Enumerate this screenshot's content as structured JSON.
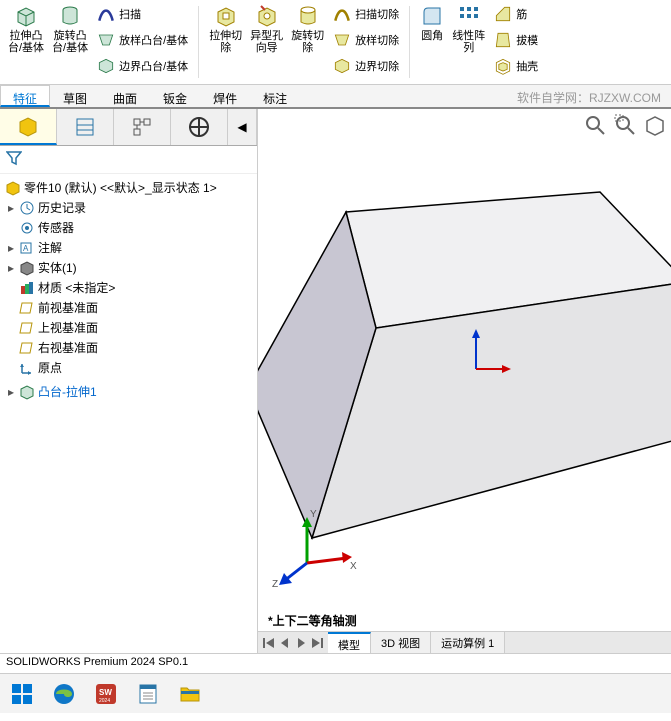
{
  "ribbon": {
    "extrude_boss": "拉伸凸\n台/基体",
    "revolve_boss": "旋转凸\n台/基体",
    "sweep": "扫描",
    "loft_boss": "放样凸台/基体",
    "boundary_boss": "边界凸台/基体",
    "extrude_cut": "拉伸切\n除",
    "hole_wizard": "异型孔\n向导",
    "revolve_cut": "旋转切\n除",
    "sweep_cut": "扫描切除",
    "loft_cut": "放样切除",
    "boundary_cut": "边界切除",
    "fillet": "圆角",
    "linear_pattern": "线性阵\n列",
    "rib": "筋",
    "draft": "拔模",
    "shell": "抽壳"
  },
  "tabs": {
    "features": "特征",
    "sketch": "草图",
    "surfaces": "曲面",
    "sheetmetal": "钣金",
    "weldments": "焊件",
    "annotate": "标注"
  },
  "watermark": "软件自学网：RJZXW.COM",
  "tree": {
    "root": "零件10 (默认) <<默认>_显示状态 1>",
    "history": "历史记录",
    "sensors": "传感器",
    "annotations": "注解",
    "solid_bodies": "实体(1)",
    "material": "材质 <未指定>",
    "front_plane": "前视基准面",
    "top_plane": "上视基准面",
    "right_plane": "右视基准面",
    "origin": "原点",
    "boss_extrude1": "凸台-拉伸1"
  },
  "view_label": "*上下二等角轴测",
  "bottom_tabs": {
    "model": "模型",
    "view3d": "3D 视图",
    "motion": "运动算例 1"
  },
  "statusbar": "SOLIDWORKS Premium 2024 SP0.1",
  "axis": {
    "x": "X",
    "y": "Y",
    "z": "Z"
  }
}
